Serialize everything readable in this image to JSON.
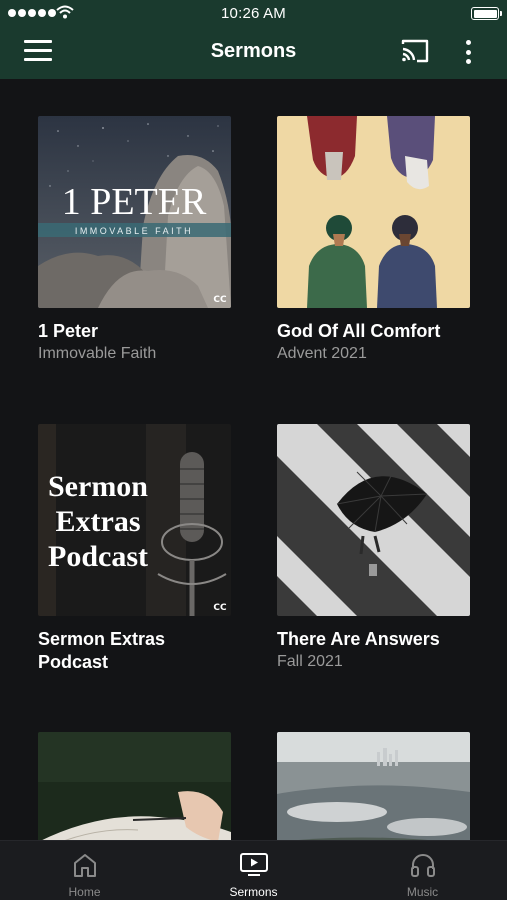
{
  "status_bar": {
    "time": "10:26 AM"
  },
  "header": {
    "title": "Sermons",
    "background": "#1a3a2e"
  },
  "cards": [
    {
      "title": "1 Peter",
      "subtitle": "Immovable Faith",
      "artwork_text": "1 PETER",
      "artwork_tagline": "IMMOVABLE FAITH",
      "artwork_logo": "CC"
    },
    {
      "title": "God Of All Comfort",
      "subtitle": "Advent 2021"
    },
    {
      "title": "Sermon Extras Podcast",
      "subtitle": "",
      "artwork_lines": [
        "Sermon",
        "Extras",
        "Podcast"
      ],
      "artwork_logo": "CC"
    },
    {
      "title": "There Are Answers",
      "subtitle": "Fall 2021"
    },
    {
      "title": "",
      "subtitle": ""
    },
    {
      "title": "",
      "subtitle": ""
    }
  ],
  "tabbar": {
    "tabs": [
      {
        "label": "Home",
        "icon": "home-icon",
        "active": false
      },
      {
        "label": "Sermons",
        "icon": "tv-play-icon",
        "active": true
      },
      {
        "label": "Music",
        "icon": "headphones-icon",
        "active": false
      }
    ]
  }
}
